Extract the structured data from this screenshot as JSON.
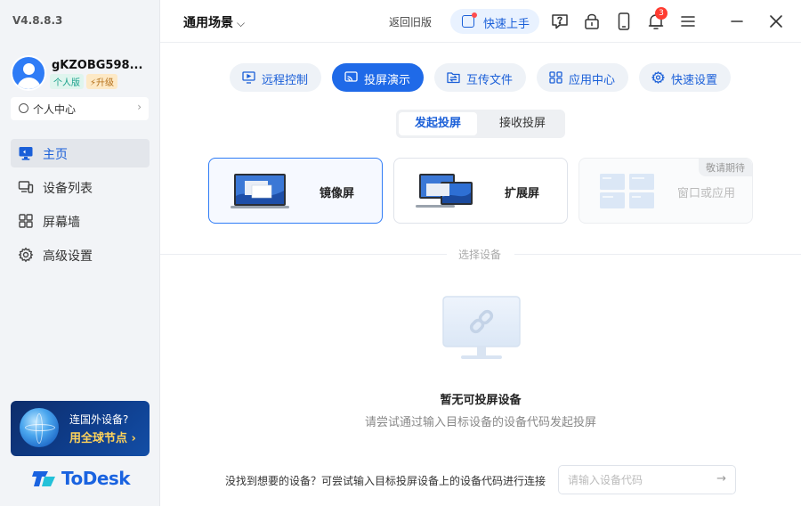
{
  "app": {
    "version": "V4.8.8.3",
    "brand": "ToDesk"
  },
  "user": {
    "name": "gKZOBG598...",
    "plan_badge": "个人版",
    "upgrade_badge": "升级",
    "personal_center": "个人中心"
  },
  "sidebar": {
    "items": [
      {
        "label": "主页",
        "icon": "monitor-icon",
        "active": true
      },
      {
        "label": "设备列表",
        "icon": "devices-icon",
        "active": false
      },
      {
        "label": "屏幕墙",
        "icon": "grid-icon",
        "active": false
      },
      {
        "label": "高级设置",
        "icon": "gear-icon",
        "active": false
      }
    ],
    "promo": {
      "line1": "连国外设备?",
      "line2": "用全球节点 ›"
    }
  },
  "topbar": {
    "scene": "通用场景",
    "back_old": "返回旧版",
    "quickstart": "快速上手",
    "notification_count": "3",
    "icons": [
      "help-icon",
      "lock-icon",
      "phone-icon",
      "bell-icon",
      "menu-icon",
      "minimize-icon",
      "close-icon"
    ]
  },
  "func_tabs": [
    {
      "label": "远程控制",
      "icon": "remote-control-icon",
      "active": false
    },
    {
      "label": "投屏演示",
      "icon": "cast-icon",
      "active": true
    },
    {
      "label": "互传文件",
      "icon": "file-transfer-icon",
      "active": false
    },
    {
      "label": "应用中心",
      "icon": "apps-icon",
      "active": false
    },
    {
      "label": "快速设置",
      "icon": "settings-icon",
      "active": false
    }
  ],
  "subtabs": [
    {
      "label": "发起投屏",
      "active": true
    },
    {
      "label": "接收投屏",
      "active": false
    }
  ],
  "modes": [
    {
      "label": "镜像屏",
      "state": "active"
    },
    {
      "label": "扩展屏",
      "state": "normal"
    },
    {
      "label": "窗口或应用",
      "state": "disabled",
      "tag": "敬请期待"
    }
  ],
  "device_section": {
    "divider_label": "选择设备",
    "empty_title": "暂无可投屏设备",
    "empty_subtitle": "请尝试通过输入目标设备的设备代码发起投屏"
  },
  "bottom": {
    "hint": "没找到想要的设备？可尝试输入目标投屏设备上的设备代码进行连接",
    "input_placeholder": "请输入设备代码"
  },
  "colors": {
    "accent": "#1f6ae8",
    "sidebar_bg": "#f2f4f7",
    "badge_red": "#ff3b30"
  }
}
